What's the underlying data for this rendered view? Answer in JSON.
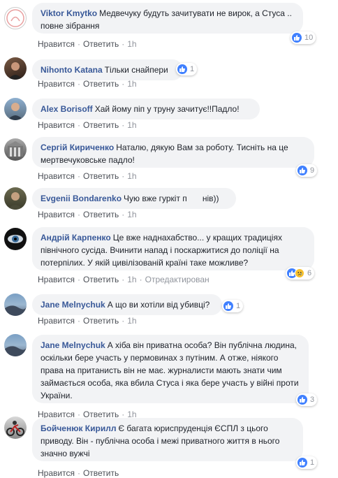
{
  "actions": {
    "like": "Нравится",
    "reply": "Ответить",
    "time": "1h",
    "edited": "Отредактирован"
  },
  "comments": [
    {
      "author": "Viktor Kmytko",
      "text": "Медвечуку будуть зачитувати не вирок, а Стуса .. повне зібрання",
      "reactions": "10",
      "avatar": "default-avatar"
    },
    {
      "author": "Nihonto Katana",
      "text": "Тільки снайпери",
      "reactions": "1",
      "avatar": "user-photo"
    },
    {
      "author": "Alex Borisoff",
      "text": "Хай йому піп у труну зачитує!!Падло!",
      "avatar": "user-photo"
    },
    {
      "author": "Сергій Кириченко",
      "text": "Наталю, дякую Вам за роботу. Тисніть на це мертвечуковське падло!",
      "reactions": "9",
      "avatar": "building-photo"
    },
    {
      "author": "Evgenii Bondarenko",
      "text": "Чую вже гуркіт п",
      "text_tail": "нів))",
      "avatar": "user-photo"
    },
    {
      "author": "Андрій Карпенко",
      "text": "Це вже наднахабство... у кращих традиціях північного сусіда. Вчинити напад і поскаржитися до поліції на потерпілих. У якій цивілізованій країні таке можливе?",
      "reactions": "6",
      "avatar": "eye-photo"
    },
    {
      "author": "Jane Melnychuk",
      "text": "А що ви хотіли від убивці?",
      "reactions": "1",
      "avatar": "landscape-photo"
    },
    {
      "author": "Jane Melnychuk",
      "text": "А хіба він приватна особа? Він публічна людина, оскільки бере участь у пермовинах з путіним. А отже, ніякого права на пританисть він не має. журналисти мають знати чим займається особа, яка вбила Стуса і яка бере участь у війні проти України.",
      "reactions": "3",
      "avatar": "landscape-photo"
    },
    {
      "author": "Бойченюк Кирилл",
      "text": "Є багата юриспруденція ЄСПЛ з цього приводу. Він - публічна особа і межі приватного життя в нього значно вужчі",
      "reactions": "1",
      "avatar": "moto-photo"
    }
  ]
}
